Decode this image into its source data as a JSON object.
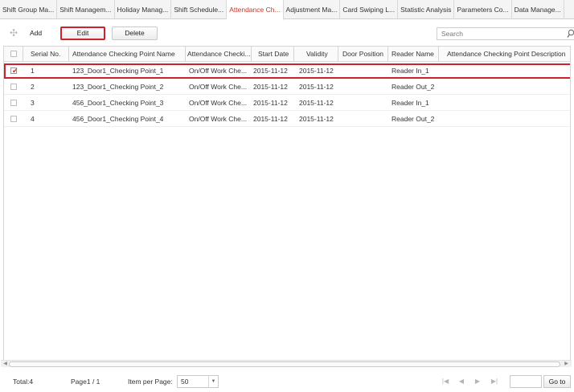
{
  "tabs": [
    {
      "label": "Shift Group Ma..."
    },
    {
      "label": "Shift Managem..."
    },
    {
      "label": "Holiday Manag..."
    },
    {
      "label": "Shift Schedule..."
    },
    {
      "label": "Attendance Ch..."
    },
    {
      "label": "Adjustment Ma..."
    },
    {
      "label": "Card Swiping L..."
    },
    {
      "label": "Statistic Analysis"
    },
    {
      "label": "Parameters Co..."
    },
    {
      "label": "Data Manage..."
    }
  ],
  "active_tab_index": 4,
  "toolbar": {
    "add_label": "Add",
    "edit_label": "Edit",
    "delete_label": "Delete",
    "search_placeholder": "Search"
  },
  "table": {
    "headers": {
      "serial": "Serial No.",
      "name": "Attendance Checking Point Name",
      "type": "Attendance Checki...",
      "start": "Start Date",
      "validity": "Validity",
      "door": "Door Position",
      "reader": "Reader Name",
      "desc": "Attendance Checking Point Description"
    },
    "rows": [
      {
        "serial": "1",
        "name": "123_Door1_Checking Point_1",
        "type": "On/Off Work Che...",
        "start": "2015-11-12",
        "validity": "2015-11-12",
        "door": "",
        "reader": "Reader In_1",
        "desc": "",
        "checked": true
      },
      {
        "serial": "2",
        "name": "123_Door1_Checking Point_2",
        "type": "On/Off Work Che...",
        "start": "2015-11-12",
        "validity": "2015-11-12",
        "door": "",
        "reader": "Reader Out_2",
        "desc": "",
        "checked": false
      },
      {
        "serial": "3",
        "name": "456_Door1_Checking Point_3",
        "type": "On/Off Work Che...",
        "start": "2015-11-12",
        "validity": "2015-11-12",
        "door": "",
        "reader": "Reader In_1",
        "desc": "",
        "checked": false
      },
      {
        "serial": "4",
        "name": "456_Door1_Checking Point_4",
        "type": "On/Off Work Che...",
        "start": "2015-11-12",
        "validity": "2015-11-12",
        "door": "",
        "reader": "Reader Out_2",
        "desc": "",
        "checked": false
      }
    ]
  },
  "footer": {
    "total": "Total:4",
    "page": "Page1 / 1",
    "items_per_page_label": "Item per Page:",
    "items_per_page_value": "50",
    "goto_label": "Go to"
  },
  "colors": {
    "accent": "#d0202e",
    "active_tab_text": "#c0392b"
  }
}
